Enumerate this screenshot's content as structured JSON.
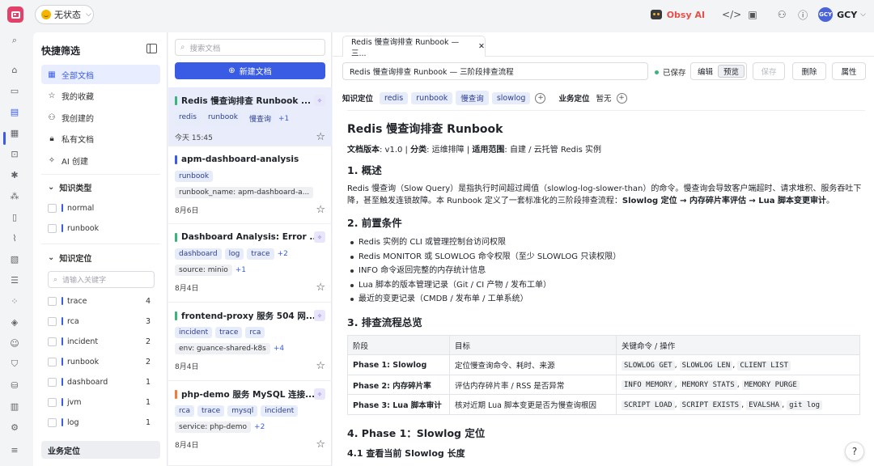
{
  "topbar": {
    "status_label": "无状态",
    "obsy_label": "Obsy AI",
    "user_initials": "GCY",
    "user_name": "GCY"
  },
  "filter": {
    "title": "快捷筛选",
    "items": [
      {
        "label": "全部文档",
        "icon": "grid-icon"
      },
      {
        "label": "我的收藏",
        "icon": "star-icon"
      },
      {
        "label": "我创建的",
        "icon": "user-icon"
      },
      {
        "label": "私有文档",
        "icon": "lock-icon"
      },
      {
        "label": "AI 创建",
        "icon": "sparkle-icon"
      }
    ],
    "knowledge_type_title": "知识类型",
    "knowledge_types": [
      "normal",
      "runbook"
    ],
    "knowledge_pos_title": "知识定位",
    "search_placeholder": "请输入关键字",
    "positions": [
      {
        "label": "trace",
        "count": "4"
      },
      {
        "label": "rca",
        "count": "3"
      },
      {
        "label": "incident",
        "count": "2"
      },
      {
        "label": "runbook",
        "count": "2"
      },
      {
        "label": "dashboard",
        "count": "1"
      },
      {
        "label": "jvm",
        "count": "1"
      },
      {
        "label": "log",
        "count": "1"
      }
    ],
    "business_title": "业务定位"
  },
  "doclist": {
    "search_placeholder": "搜索文档",
    "new_button": "新建文档",
    "cards": [
      {
        "title": "Redis 慢查询排查 Runbook ...",
        "bar": "#3bb37a",
        "tags": [
          "redis",
          "runbook",
          "慢查询"
        ],
        "more": "+1",
        "date": "今天 15:45"
      },
      {
        "title": "apm-dashboard-analysis",
        "bar": "#3a5ce5",
        "tags": [
          "runbook"
        ],
        "tag2": "runbook_name: apm-dashboard-a...",
        "date": "8月6日"
      },
      {
        "title": "Dashboard Analysis: Error ...",
        "bar": "#3bb37a",
        "tags": [
          "dashboard",
          "log",
          "trace"
        ],
        "more": "+2",
        "tag2": "source: minio",
        "more2": "+1",
        "date": "8月4日"
      },
      {
        "title": "frontend-proxy 服务 504 网...",
        "bar": "#3bb37a",
        "tags": [
          "incident",
          "trace",
          "rca"
        ],
        "tag2": "env: guance-shared-k8s",
        "more2": "+4",
        "date": "8月4日"
      },
      {
        "title": "php-demo 服务 MySQL 连接...",
        "bar": "#f07c3a",
        "tags": [
          "rca",
          "trace",
          "mysql",
          "incident"
        ],
        "tag2": "service: php-demo",
        "more2": "+2",
        "date": "8月4日"
      }
    ]
  },
  "editor": {
    "tab_title": "Redis 慢查询排查 Runbook — 三...",
    "title_value": "Redis 慢查询排查 Runbook — 三阶段排查流程",
    "saved": "已保存",
    "edit": "编辑",
    "preview": "预览",
    "save": "保存",
    "delete": "删除",
    "props": "属性",
    "knowledge_pos_label": "知识定位",
    "knowledge_tags": [
      "redis",
      "runbook",
      "慢查询",
      "slowlog"
    ],
    "business_label": "业务定位",
    "business_value": "暂无"
  },
  "doc": {
    "h1": "Redis 慢查询排查 Runbook",
    "meta_k1": "文档版本",
    "meta_v1": ": v1.0 | ",
    "meta_k2": "分类",
    "meta_v2": ": 运维排障 | ",
    "meta_k3": "适用范围",
    "meta_v3": ": 自建 / 云托管 Redis 实例",
    "s1": "1. 概述",
    "p1": "Redis 慢查询（Slow Query）是指执行时间超过阈值（slowlog-log-slower-than）的命令。慢查询会导致客户端超时、请求堆积、服务吞吐下降，甚至触发连锁故障。本 Runbook 定义了一套标准化的三阶段排查流程：",
    "p1b": "Slowlog 定位 → 内存碎片率评估 → Lua 脚本变更审计",
    "p1c": "。",
    "s2": "2. 前置条件",
    "pre": [
      "Redis 实例的 CLI 或管理控制台访问权限",
      "Redis MONITOR 或 SLOWLOG 命令权限（至少 SLOWLOG 只读权限）",
      "INFO 命令返回完整的内存统计信息",
      "Lua 脚本的版本管理记录（Git / CI 产物 / 发布工单）",
      "最近的变更记录（CMDB / 发布单 / 工单系统）"
    ],
    "s3": "3. 排查流程总览",
    "table_head": [
      "阶段",
      "目标",
      "关键命令 / 操作"
    ],
    "rows": [
      {
        "stage": "Phase 1: Slowlog",
        "goal": "定位慢查询命令、耗时、来源",
        "cmds": [
          "SLOWLOG GET",
          "SLOWLOG LEN",
          "CLIENT LIST"
        ]
      },
      {
        "stage": "Phase 2: 内存碎片率",
        "goal": "评估内存碎片率 / RSS 是否异常",
        "cmds": [
          "INFO MEMORY",
          "MEMORY STATS",
          "MEMORY PURGE"
        ]
      },
      {
        "stage": "Phase 3: Lua 脚本审计",
        "goal": "核对近期 Lua 脚本变更是否为慢查询根因",
        "cmds": [
          "SCRIPT LOAD",
          "SCRIPT EXISTS",
          "EVALSHA",
          "git log"
        ]
      }
    ],
    "s4": "4. Phase 1：Slowlog 定位",
    "s41": "4.1 查看当前 Slowlog 长度"
  }
}
